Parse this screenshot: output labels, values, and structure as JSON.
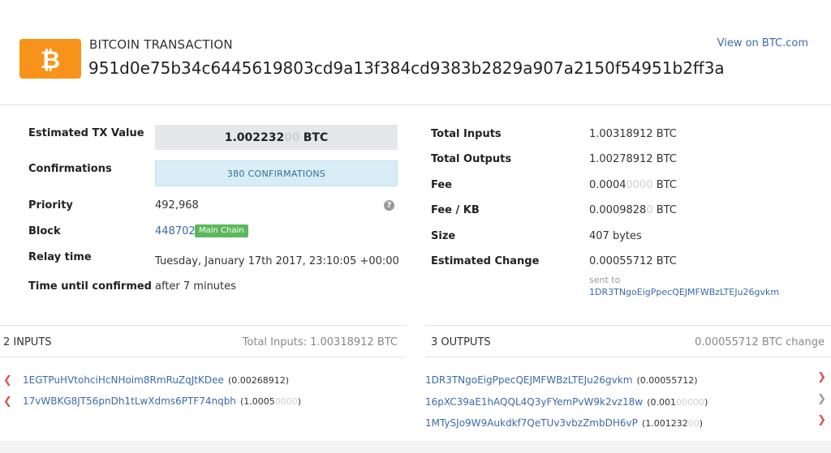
{
  "header": {
    "label": "BITCOIN TRANSACTION",
    "hash": "951d0e75b34c6445619803cd9a13f384cd9383b2829a907a2150f54951b2ff3a",
    "view_link": "View on BTC.com",
    "logo_icon": "bitcoin-logo-icon",
    "brand_color": "#f7931a"
  },
  "left": {
    "tx_value": {
      "label": "Estimated TX Value",
      "main": "1.002232",
      "faded": "00",
      "unit": "BTC"
    },
    "confirmations": {
      "label": "Confirmations",
      "value": "380 CONFIRMATIONS"
    },
    "priority": {
      "label": "Priority",
      "value": "492,968",
      "help_icon": "help-icon"
    },
    "block": {
      "label": "Block",
      "value": "448702",
      "badge": "Main Chain"
    },
    "relay": {
      "label": "Relay time",
      "value": "Tuesday, January 17th 2017, 23:10:05 +00:00"
    },
    "until_confirmed": {
      "label": "Time until confirmed",
      "value": "after 7 minutes"
    }
  },
  "right": {
    "total_inputs": {
      "label": "Total Inputs",
      "value": "1.00318912 BTC"
    },
    "total_outputs": {
      "label": "Total Outputs",
      "value": "1.00278912 BTC"
    },
    "fee": {
      "label": "Fee",
      "main": "0.0004",
      "faded": "0000",
      "unit": " BTC"
    },
    "fee_kb": {
      "label": "Fee / KB",
      "main": "0.0009828",
      "faded": "0",
      "unit": " BTC"
    },
    "size": {
      "label": "Size",
      "value": "407 bytes"
    },
    "est_change": {
      "label": "Estimated Change",
      "value": "0.00055712 BTC",
      "sent_to_label": "sent to",
      "sent_to_addr": "1DR3TNgoEigPpecQEJMFWBzLTEJu26gvkm"
    }
  },
  "inputs": {
    "title": "2 INPUTS",
    "total": "Total Inputs: 1.00318912 BTC",
    "items": [
      {
        "address": "1EGTPuHVtohciHcNHoim8RmRuZqJtKDee",
        "amount_main": "(0.00268912)",
        "amount_faded": "",
        "amount_close": ""
      },
      {
        "address": "17vWBKG8JT56pnDh1tLwXdms6PTF74nqbh",
        "amount_main": "(1.0005",
        "amount_faded": "0000",
        "amount_close": ")"
      }
    ]
  },
  "outputs": {
    "title": "3 OUTPUTS",
    "change": "0.00055712 BTC change",
    "items": [
      {
        "address": "1DR3TNgoEigPpecQEJMFWBzLTEJu26gvkm",
        "amount_main": "(0.00055712)",
        "amount_faded": "",
        "amount_close": "",
        "chevron_color": "#d9534f"
      },
      {
        "address": "16pXC39aE1hAQQL4Q3yFYemPvW9k2vz18w",
        "amount_main": "(0.001",
        "amount_faded": "00000",
        "amount_close": ")",
        "chevron_color": "#999999"
      },
      {
        "address": "1MTySJo9W9Aukdkf7QeTUv3vbzZmbDH6vP",
        "amount_main": "(1.001232",
        "amount_faded": "00",
        "amount_close": ")",
        "chevron_color": "#d9534f"
      }
    ]
  },
  "colors": {
    "link": "#3c6aa8",
    "success": "#5cb85c",
    "danger": "#d9534f",
    "info_bg": "#d9edf7"
  }
}
